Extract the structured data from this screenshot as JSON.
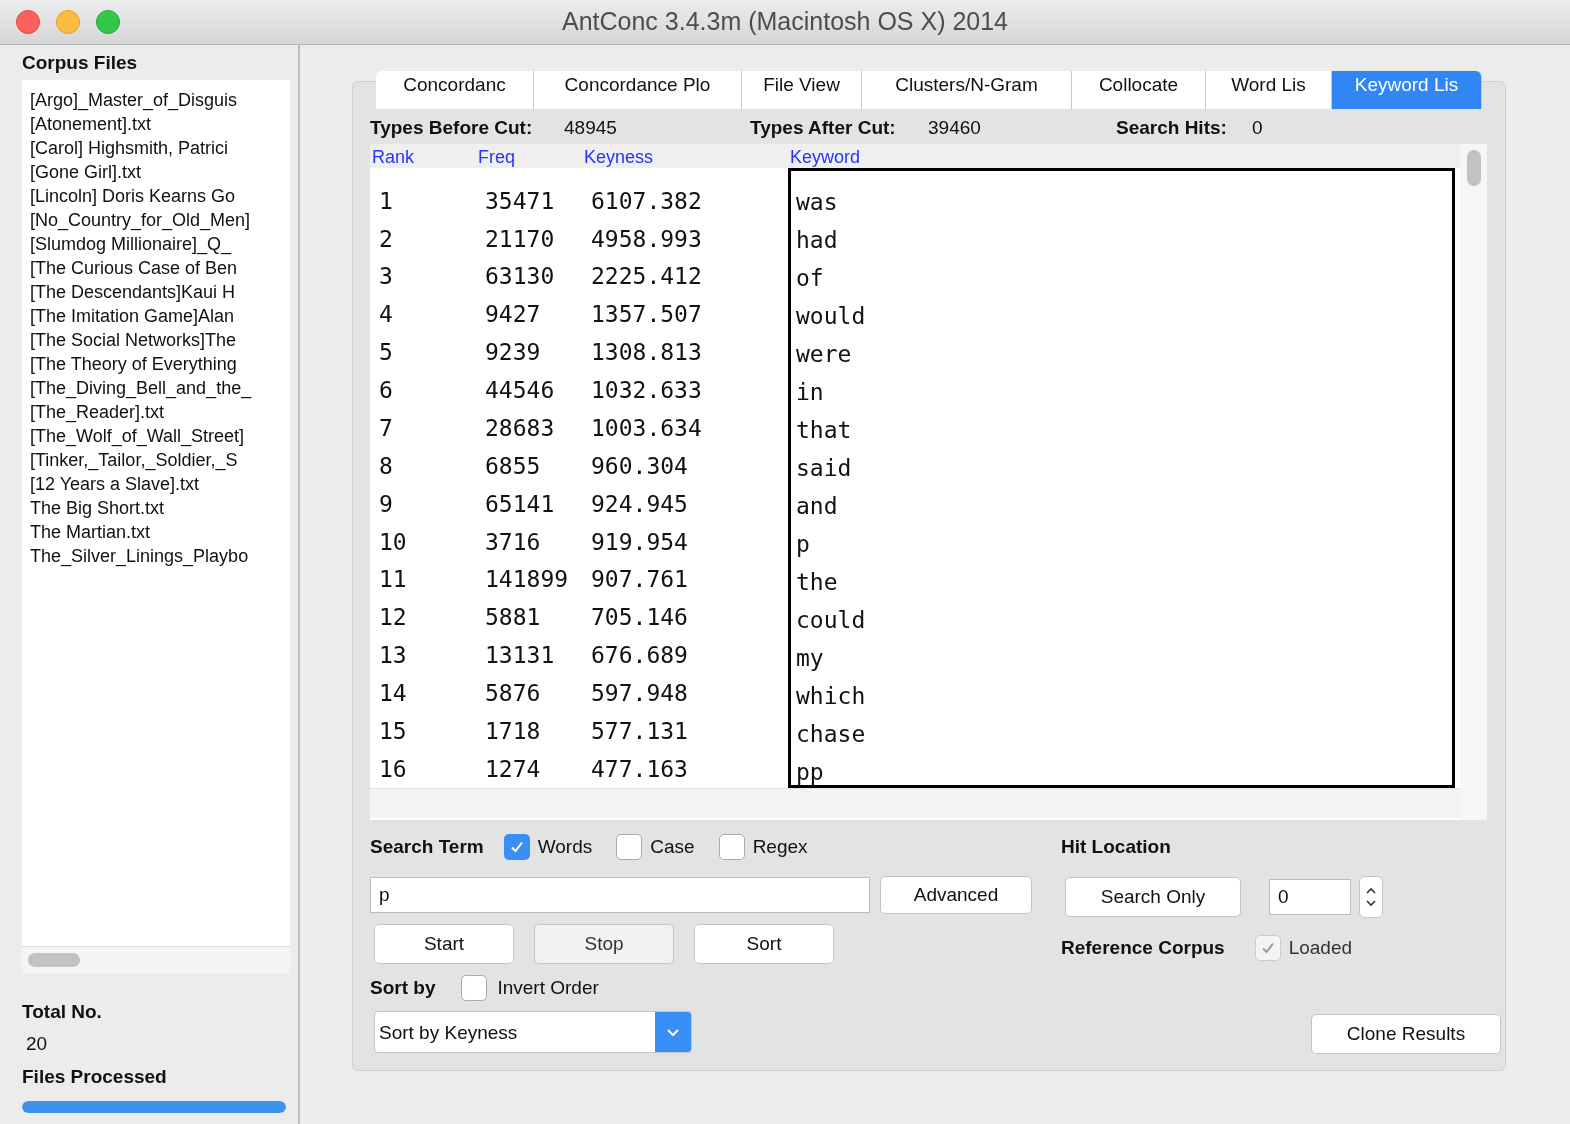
{
  "window": {
    "title": "AntConc 3.4.3m (Macintosh OS X) 2014"
  },
  "corpus_files": {
    "title": "Corpus Files",
    "files": [
      "[Argo]_Master_of_Disguis",
      "[Atonement].txt",
      "[Carol] Highsmith, Patrici",
      "[Gone Girl].txt",
      "[Lincoln] Doris Kearns Go",
      "[No_Country_for_Old_Men]",
      "[Slumdog Millionaire]_Q_",
      "[The Curious Case of Ben",
      "[The Descendants]Kaui H",
      "[The Imitation Game]Alan",
      "[The Social Networks]The",
      "[The Theory of Everything",
      "[The_Diving_Bell_and_the_",
      "[The_Reader].txt",
      "[The_Wolf_of_Wall_Street]",
      "[Tinker,_Tailor,_Soldier,_S",
      "[12 Years a Slave].txt",
      "The Big Short.txt",
      "The Martian.txt",
      "The_Silver_Linings_Playbo"
    ],
    "total_label": "Total No.",
    "total_value": "20",
    "processed_label": "Files Processed",
    "progress": {
      "level": 1
    }
  },
  "tabs": [
    {
      "label": "Concordanc",
      "selected": false
    },
    {
      "label": "Concordance Plo",
      "selected": false
    },
    {
      "label": "File View",
      "selected": false
    },
    {
      "label": "Clusters/N-Gram",
      "selected": false
    },
    {
      "label": "Collocate",
      "selected": false
    },
    {
      "label": "Word Lis",
      "selected": false
    },
    {
      "label": "Keyword Lis",
      "selected": true
    }
  ],
  "stats": [
    {
      "label": "Types Before Cut:",
      "value": "48945"
    },
    {
      "label": "Types After Cut:",
      "value": "39460"
    },
    {
      "label": "Search Hits:",
      "value": "0"
    }
  ],
  "table": {
    "columns": [
      "Rank",
      "Freq",
      "Keyness",
      "Keyword"
    ],
    "rows": [
      [
        "1",
        "35471",
        "6107.382",
        "was"
      ],
      [
        "2",
        "21170",
        "4958.993",
        "had"
      ],
      [
        "3",
        "63130",
        "2225.412",
        "of"
      ],
      [
        "4",
        "9427",
        "1357.507",
        "would"
      ],
      [
        "5",
        "9239",
        "1308.813",
        "were"
      ],
      [
        "6",
        "44546",
        "1032.633",
        "in"
      ],
      [
        "7",
        "28683",
        "1003.634",
        "that"
      ],
      [
        "8",
        "6855",
        "960.304",
        "said"
      ],
      [
        "9",
        "65141",
        "924.945",
        "and"
      ],
      [
        "10",
        "3716",
        "919.954",
        "p"
      ],
      [
        "11",
        "141899",
        "907.761",
        "the"
      ],
      [
        "12",
        "5881",
        "705.146",
        "could"
      ],
      [
        "13",
        "13131",
        "676.689",
        "my"
      ],
      [
        "14",
        "5876",
        "597.948",
        "which"
      ],
      [
        "15",
        "1718",
        "577.131",
        "chase"
      ],
      [
        "16",
        "1274",
        "477.163",
        "pp"
      ]
    ]
  },
  "search": {
    "label": "Search Term",
    "options": [
      {
        "label": "Words",
        "checked": true
      },
      {
        "label": "Case",
        "checked": false
      },
      {
        "label": "Regex",
        "checked": false
      }
    ],
    "value": "p",
    "advanced": "Advanced",
    "buttons": [
      {
        "label": "Start",
        "disabled": false
      },
      {
        "label": "Stop",
        "disabled": true
      },
      {
        "label": "Sort",
        "disabled": false
      }
    ]
  },
  "hit_location": {
    "label": "Hit Location",
    "button": "Search Only",
    "value": "0"
  },
  "reference_corpus": {
    "label": "Reference Corpus",
    "loaded_label": "Loaded",
    "loaded": true
  },
  "sort": {
    "label": "Sort by",
    "invert_label": "Invert Order",
    "invert": false,
    "selected": "Sort by Keyness"
  },
  "clone_button": "Clone Results"
}
